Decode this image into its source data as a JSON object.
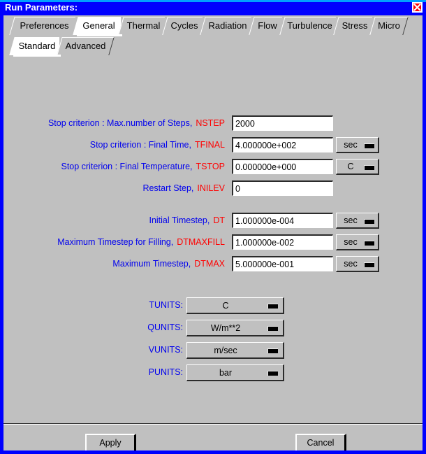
{
  "window": {
    "title": "Run Parameters:",
    "close_icon": "close-icon",
    "titlebar_color": "#0000ff",
    "face_color": "#c0c0c0",
    "label_color": "#0000ee",
    "variable_color": "#ff0000"
  },
  "tabs_primary": [
    {
      "label": "Preferences",
      "selected": false
    },
    {
      "label": "General",
      "selected": true
    },
    {
      "label": "Thermal",
      "selected": false
    },
    {
      "label": "Cycles",
      "selected": false
    },
    {
      "label": "Radiation",
      "selected": false
    },
    {
      "label": "Flow",
      "selected": false
    },
    {
      "label": "Turbulence",
      "selected": false
    },
    {
      "label": "Stress",
      "selected": false
    },
    {
      "label": "Micro",
      "selected": false
    }
  ],
  "tabs_secondary": [
    {
      "label": "Standard",
      "selected": true
    },
    {
      "label": "Advanced",
      "selected": false
    }
  ],
  "fields": [
    {
      "label": "Stop criterion : Max.number of Steps,",
      "variable": "NSTEP",
      "value": "2000",
      "unit": null
    },
    {
      "label": "Stop criterion : Final Time,",
      "variable": "TFINAL",
      "value": "4.000000e+002",
      "unit": "sec"
    },
    {
      "label": "Stop criterion : Final Temperature,",
      "variable": "TSTOP",
      "value": "0.000000e+000",
      "unit": "C"
    },
    {
      "label": "Restart Step,",
      "variable": "INILEV",
      "value": "0",
      "unit": null
    },
    {
      "label": "Initial Timestep,",
      "variable": "DT",
      "value": "1.000000e-004",
      "unit": "sec"
    },
    {
      "label": "Maximum Timestep for Filling,",
      "variable": "DTMAXFILL",
      "value": "1.000000e-002",
      "unit": "sec"
    },
    {
      "label": "Maximum Timestep,",
      "variable": "DTMAX",
      "value": "5.000000e-001",
      "unit": "sec"
    }
  ],
  "units": [
    {
      "label": "TUNITS:",
      "value": "C"
    },
    {
      "label": "QUNITS:",
      "value": "W/m**2"
    },
    {
      "label": "VUNITS:",
      "value": "m/sec"
    },
    {
      "label": "PUNITS:",
      "value": "bar"
    }
  ],
  "actions": {
    "apply_label": "Apply",
    "cancel_label": "Cancel"
  }
}
